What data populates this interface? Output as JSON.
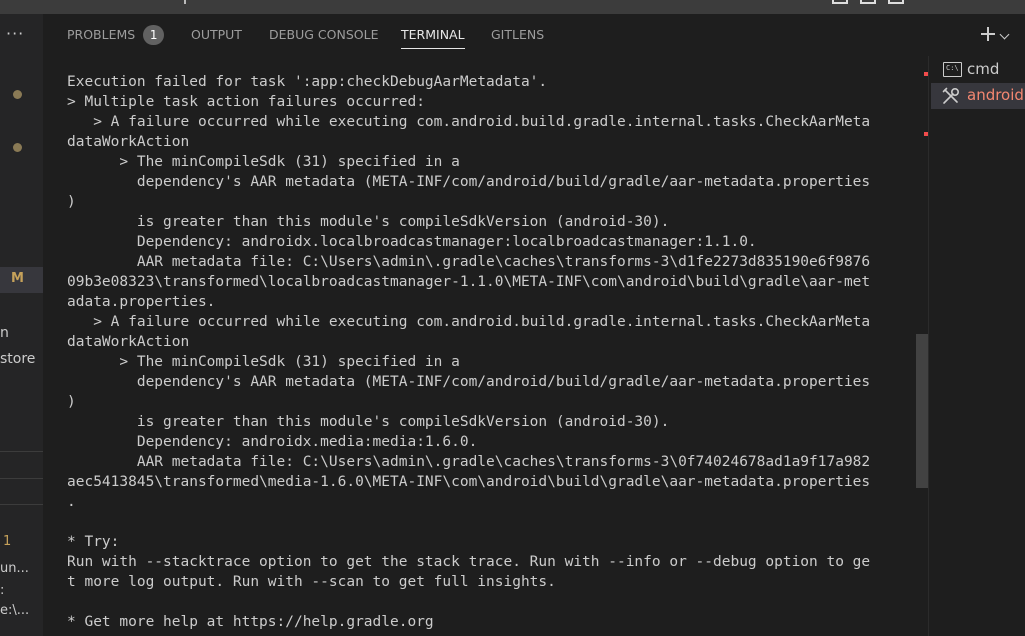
{
  "panel": {
    "tabs": [
      {
        "label": "PROBLEMS",
        "badge": "1"
      },
      {
        "label": "OUTPUT"
      },
      {
        "label": "DEBUG CONSOLE"
      },
      {
        "label": "TERMINAL",
        "active": true
      },
      {
        "label": "GITLENS"
      }
    ]
  },
  "sidebar": {
    "more": "···",
    "badge_m": "M",
    "frag1": "n",
    "frag2": "store",
    "count": "1",
    "frag3": "un...",
    "frag4": ":",
    "frag5": "e:\\..."
  },
  "terminal": {
    "lines": [
      "Execution failed for task ':app:checkDebugAarMetadata'.",
      "> Multiple task action failures occurred:",
      "   > A failure occurred while executing com.android.build.gradle.internal.tasks.CheckAarMeta",
      "dataWorkAction",
      "      > The minCompileSdk (31) specified in a",
      "        dependency's AAR metadata (META-INF/com/android/build/gradle/aar-metadata.properties",
      ")",
      "        is greater than this module's compileSdkVersion (android-30).",
      "        Dependency: androidx.localbroadcastmanager:localbroadcastmanager:1.1.0.",
      "        AAR metadata file: C:\\Users\\admin\\.gradle\\caches\\transforms-3\\d1fe2273d835190e6f9876",
      "09b3e08323\\transformed\\localbroadcastmanager-1.1.0\\META-INF\\com\\android\\build\\gradle\\aar-met",
      "adata.properties.",
      "   > A failure occurred while executing com.android.build.gradle.internal.tasks.CheckAarMeta",
      "dataWorkAction",
      "      > The minCompileSdk (31) specified in a",
      "        dependency's AAR metadata (META-INF/com/android/build/gradle/aar-metadata.properties",
      ")",
      "        is greater than this module's compileSdkVersion (android-30).",
      "        Dependency: androidx.media:media:1.6.0.",
      "        AAR metadata file: C:\\Users\\admin\\.gradle\\caches\\transforms-3\\0f74024678ad1a9f17a982",
      "aec5413845\\transformed\\media-1.6.0\\META-INF\\com\\android\\build\\gradle\\aar-metadata.properties",
      ".",
      "",
      "* Try:",
      "Run with --stacktrace option to get the stack trace. Run with --info or --debug option to ge",
      "t more log output. Run with --scan to get full insights.",
      "",
      "* Get more help at https://help.gradle.org"
    ]
  },
  "instances": [
    {
      "label": "cmd",
      "icon": "terminal-cmd-icon"
    },
    {
      "label": "android",
      "icon": "tools-icon",
      "selected": true
    }
  ],
  "colors": {
    "background": "#1e1e1e",
    "sidebar": "#252526",
    "selected_instance_text": "#f48771",
    "scroll_marker": "#f14c4c"
  }
}
